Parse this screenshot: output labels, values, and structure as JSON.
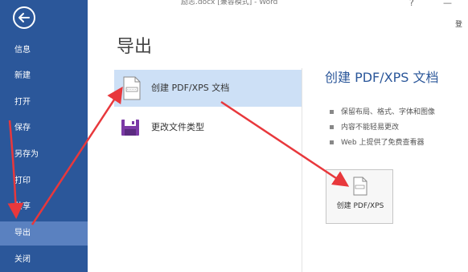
{
  "window": {
    "title": "励志.docx [兼容模式] - Word",
    "help": "?",
    "close": "✕",
    "minimize": "—",
    "signin_partial": "登"
  },
  "sidebar": {
    "items": [
      {
        "label": "信息"
      },
      {
        "label": "新建"
      },
      {
        "label": "打开"
      },
      {
        "label": "保存"
      },
      {
        "label": "另存为"
      },
      {
        "label": "打印"
      },
      {
        "label": "共享"
      },
      {
        "label": "导出"
      },
      {
        "label": "关闭"
      }
    ],
    "active_index": 7
  },
  "main": {
    "title": "导出",
    "options": [
      {
        "label": "创建 PDF/XPS 文档",
        "icon": "pdf-document-icon",
        "selected": true
      },
      {
        "label": "更改文件类型",
        "icon": "change-file-type-icon",
        "selected": false
      }
    ]
  },
  "detail": {
    "title": "创建 PDF/XPS 文档",
    "bullets": [
      "保留布局、格式、字体和图像",
      "内容不能轻易更改",
      "Web 上提供了免费查看器"
    ],
    "button_label": "创建 PDF/XPS",
    "button_icon": "pdf-xps-icon"
  },
  "colors": {
    "sidebar_bg": "#2b579a",
    "sidebar_active": "#5a81c0",
    "selected_option": "#cde0f6",
    "accent_title": "#2b579a",
    "annotation_arrow": "#e8383c"
  }
}
